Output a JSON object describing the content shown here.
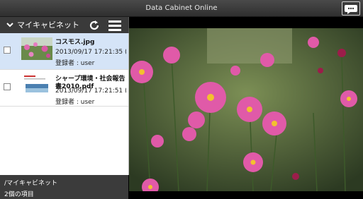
{
  "app": {
    "title": "Data Cabinet Online"
  },
  "sidebar": {
    "folder_label": "マイキャビネット",
    "items": [
      {
        "name": "コスモス.jpg",
        "date": "2013/09/17 17:21:35 (.",
        "user": "登録者 : user",
        "selected": true
      },
      {
        "name": "シャープ環境・社会報告書2010.pdf",
        "date": "2013/09/17 17:21:51 (.",
        "user": "登録者 : user",
        "selected": false
      }
    ]
  },
  "status": {
    "path": "/マイキャビネット",
    "count": "2個の項目"
  },
  "colors": {
    "selected_row": "#d5e4f7",
    "titlebar": "#3a3a3a",
    "flower": "#e05aa8"
  },
  "icons": [
    "chevron-down-icon",
    "refresh-icon",
    "menu-icon",
    "chat-icon",
    "checkbox-icon"
  ]
}
